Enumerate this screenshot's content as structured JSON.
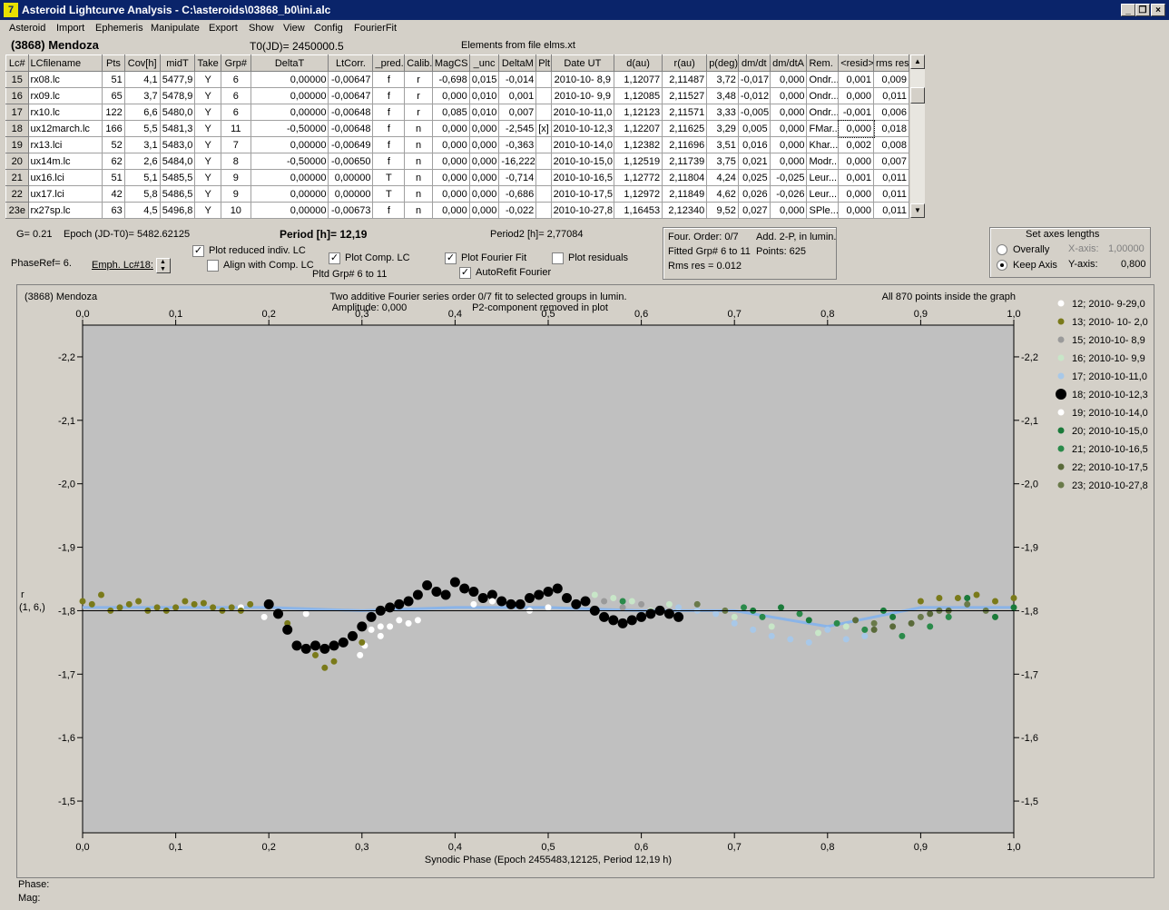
{
  "window": {
    "title": "Asteroid Lightcurve Analysis - C:\\asteroids\\03868_b0\\ini.alc",
    "min_label": "_",
    "max_label": "❐",
    "close_label": "×"
  },
  "menu": [
    "Asteroid",
    "Import",
    "Ephemeris",
    "Manipulate",
    "Export",
    "Show",
    "View",
    "Config",
    "FourierFit"
  ],
  "header": {
    "asteroid": "(3868) Mendoza",
    "t0": "T0(JD)= 2450000.5",
    "elements": "Elements from file elms.xt"
  },
  "table": {
    "columns": [
      "Lc#",
      "LCfilename",
      "Pts",
      "Cov[h]",
      "midT",
      "Take",
      "Grp#",
      "DeltaT",
      "LtCorr.",
      "_pred.",
      "Calib.",
      "MagCS",
      "_unc",
      "DeltaM",
      "Plt",
      "Date UT",
      "d(au)",
      "r(au)",
      "p(deg)",
      "dm/dt",
      "dm/dtA",
      "Rem.",
      "<resid>",
      "rms res"
    ],
    "rows": [
      [
        "15",
        "rx08.lc",
        "51",
        "4,1",
        "5477,9",
        "Y",
        "6",
        "0,00000",
        "-0,00647",
        "f",
        "r",
        "-0,698",
        "0,015",
        "-0,014",
        "",
        "2010-10- 8,9",
        "1,12077",
        "2,11487",
        "3,72",
        "-0,017",
        "0,000",
        "Ondr...",
        "0,001",
        "0,009"
      ],
      [
        "16",
        "rx09.lc",
        "65",
        "3,7",
        "5478,9",
        "Y",
        "6",
        "0,00000",
        "-0,00647",
        "f",
        "r",
        "0,000",
        "0,010",
        "0,001",
        "",
        "2010-10- 9,9",
        "1,12085",
        "2,11527",
        "3,48",
        "-0,012",
        "0,000",
        "Ondr...",
        "0,000",
        "0,011"
      ],
      [
        "17",
        "rx10.lc",
        "122",
        "6,6",
        "5480,0",
        "Y",
        "6",
        "0,00000",
        "-0,00648",
        "f",
        "r",
        "0,085",
        "0,010",
        "0,007",
        "",
        "2010-10-11,0",
        "1,12123",
        "2,11571",
        "3,33",
        "-0,005",
        "0,000",
        "Ondr...",
        "-0,001",
        "0,006"
      ],
      [
        "18",
        "ux12march.lc",
        "166",
        "5,5",
        "5481,3",
        "Y",
        "11",
        "-0,50000",
        "-0,00648",
        "f",
        "n",
        "0,000",
        "0,000",
        "-2,545",
        "[x]",
        "2010-10-12,3",
        "1,12207",
        "2,11625",
        "3,29",
        "0,005",
        "0,000",
        "FMar...",
        "0,000",
        "0,018"
      ],
      [
        "19",
        "rx13.lci",
        "52",
        "3,1",
        "5483,0",
        "Y",
        "7",
        "0,00000",
        "-0,00649",
        "f",
        "n",
        "0,000",
        "0,000",
        "-0,363",
        "",
        "2010-10-14,0",
        "1,12382",
        "2,11696",
        "3,51",
        "0,016",
        "0,000",
        "Khar...",
        "0,002",
        "0,008"
      ],
      [
        "20",
        "ux14m.lc",
        "62",
        "2,6",
        "5484,0",
        "Y",
        "8",
        "-0,50000",
        "-0,00650",
        "f",
        "n",
        "0,000",
        "0,000",
        "-16,222",
        "",
        "2010-10-15,0",
        "1,12519",
        "2,11739",
        "3,75",
        "0,021",
        "0,000",
        "Modr...",
        "0,000",
        "0,007"
      ],
      [
        "21",
        "ux16.lci",
        "51",
        "5,1",
        "5485,5",
        "Y",
        "9",
        "0,00000",
        "0,00000",
        "T",
        "n",
        "0,000",
        "0,000",
        "-0,714",
        "",
        "2010-10-16,5",
        "1,12772",
        "2,11804",
        "4,24",
        "0,025",
        "-0,025",
        "Leur...",
        "0,001",
        "0,011"
      ],
      [
        "22",
        "ux17.lci",
        "42",
        "5,8",
        "5486,5",
        "Y",
        "9",
        "0,00000",
        "0,00000",
        "T",
        "n",
        "0,000",
        "0,000",
        "-0,686",
        "",
        "2010-10-17,5",
        "1,12972",
        "2,11849",
        "4,62",
        "0,026",
        "-0,026",
        "Leur...",
        "0,000",
        "0,011"
      ],
      [
        "23e",
        "rx27sp.lc",
        "63",
        "4,5",
        "5496,8",
        "Y",
        "10",
        "0,00000",
        "-0,00673",
        "f",
        "n",
        "0,000",
        "0,000",
        "-0,022",
        "",
        "2010-10-27,8",
        "1,16453",
        "2,12340",
        "9,52",
        "0,027",
        "0,000",
        "SPle...",
        "0,000",
        "0,011"
      ]
    ]
  },
  "info": {
    "g": "G= 0.21",
    "epoch": "Epoch (JD-T0)= 5482.62125",
    "period": "Period [h]= 12,19",
    "period2": "Period2 [h]= 2,77084",
    "phaseref": "PhaseRef= 6.",
    "emph": "Emph. Lc#18:",
    "plot_reduced": "Plot reduced indiv. LC",
    "align_comp": "Align with Comp. LC",
    "plot_comp": "Plot Comp. LC",
    "pltd_grp": "Pltd Grp#  6  to   11",
    "plot_fourier": "Plot Fourier Fit",
    "autorefit": "AutoRefit Fourier",
    "plot_residuals": "Plot residuals",
    "four_order": "Four. Order:  0/7",
    "add2p": "Add. 2-P, in lumin.",
    "fitted_grp": "Fitted Grp# 6 to 11",
    "points": "Points: 625",
    "rms": "Rms res      = 0.012",
    "axes_title": "Set axes lengths",
    "overally": "Overally",
    "keep_axis": "Keep Axis",
    "xaxis_label": "X-axis:",
    "xaxis_val": "1,00000",
    "yaxis_label": "Y-axis:",
    "yaxis_val": "0,800"
  },
  "chart_data": {
    "type": "scatter",
    "name_label": "(3868) Mendoza",
    "title": "Two additive Fourier series order 0/7 fit to selected groups in lumin.",
    "subtitle_left": "Amplitude: 0,000",
    "subtitle_right": "P2-component removed in plot",
    "note": "All 870 points inside the graph",
    "xlabel": "Synodic Phase (Epoch 2455483,12125, Period 12,19 h)",
    "ylabel": "r",
    "ylabel2": "(1, 6,)",
    "xlim": [
      0.0,
      1.0
    ],
    "ylim": [
      -2.25,
      -1.45
    ],
    "x_ticks": [
      "0,0",
      "0,1",
      "0,2",
      "0,3",
      "0,4",
      "0,5",
      "0,6",
      "0,7",
      "0,8",
      "0,9",
      "1,0"
    ],
    "y_ticks": [
      {
        "v": -2.2,
        "t": "-2,2"
      },
      {
        "v": -2.1,
        "t": "-2,1"
      },
      {
        "v": -2.0,
        "t": "-2,0"
      },
      {
        "v": -1.9,
        "t": "-1,9"
      },
      {
        "v": -1.8,
        "t": "-1,8"
      },
      {
        "v": -1.7,
        "t": "-1,7"
      },
      {
        "v": -1.6,
        "t": "-1,6"
      },
      {
        "v": -1.5,
        "t": "-1,5"
      }
    ],
    "reference_line": -1.8,
    "fit_color": "#8ab4e8",
    "series": [
      {
        "name": "12; 2010- 9-29,0",
        "color": "#ffffff",
        "x": [
          0.17,
          0.195,
          0.24,
          0.298,
          0.303,
          0.32,
          0.33,
          0.35,
          0.36,
          0.48,
          0.5
        ],
        "y": [
          -1.805,
          -1.79,
          -1.795,
          -1.73,
          -1.745,
          -1.76,
          -1.775,
          -1.78,
          -1.785,
          -1.8,
          -1.805
        ]
      },
      {
        "name": "13; 2010- 10- 2,0",
        "color": "#7a7a1a",
        "x": [
          0.0,
          0.01,
          0.02,
          0.03,
          0.04,
          0.05,
          0.06,
          0.07,
          0.08,
          0.09,
          0.1,
          0.11,
          0.12,
          0.13,
          0.14,
          0.15,
          0.16,
          0.17,
          0.18,
          0.22,
          0.25,
          0.26,
          0.27,
          0.3,
          0.9,
          0.92,
          0.94,
          0.96,
          0.98,
          1.0
        ],
        "y": [
          -1.815,
          -1.81,
          -1.825,
          -1.8,
          -1.805,
          -1.81,
          -1.815,
          -1.8,
          -1.805,
          -1.8,
          -1.805,
          -1.815,
          -1.81,
          -1.812,
          -1.805,
          -1.8,
          -1.805,
          -1.8,
          -1.81,
          -1.78,
          -1.73,
          -1.71,
          -1.72,
          -1.75,
          -1.815,
          -1.82,
          -1.82,
          -1.825,
          -1.815,
          -1.82
        ]
      },
      {
        "name": "15; 2010-10- 8,9",
        "color": "#9a9a9a",
        "x": [
          0.56,
          0.58,
          0.6,
          0.62
        ],
        "y": [
          -1.815,
          -1.805,
          -1.81,
          -1.8
        ]
      },
      {
        "name": "16; 2010-10- 9,9",
        "color": "#c8e6c8",
        "x": [
          0.55,
          0.57,
          0.59,
          0.61,
          0.63,
          0.7,
          0.74,
          0.79,
          0.82
        ],
        "y": [
          -1.825,
          -1.82,
          -1.815,
          -1.8,
          -1.81,
          -1.79,
          -1.775,
          -1.765,
          -1.775
        ]
      },
      {
        "name": "17; 2010-10-11,0",
        "color": "#a8c8e8",
        "x": [
          0.64,
          0.66,
          0.68,
          0.7,
          0.72,
          0.74,
          0.76,
          0.78,
          0.8,
          0.82,
          0.84
        ],
        "y": [
          -1.805,
          -1.8,
          -1.795,
          -1.78,
          -1.77,
          -1.76,
          -1.755,
          -1.75,
          -1.77,
          -1.755,
          -1.76
        ]
      },
      {
        "name": "18; 2010-10-12,3",
        "color": "#000000",
        "x": [
          0.2,
          0.21,
          0.22,
          0.23,
          0.24,
          0.25,
          0.26,
          0.27,
          0.28,
          0.29,
          0.3,
          0.31,
          0.32,
          0.33,
          0.34,
          0.35,
          0.36,
          0.37,
          0.38,
          0.39,
          0.4,
          0.41,
          0.42,
          0.43,
          0.44,
          0.45,
          0.46,
          0.47,
          0.48,
          0.49,
          0.5,
          0.51,
          0.52,
          0.53,
          0.54,
          0.55,
          0.56,
          0.57,
          0.58,
          0.59,
          0.6,
          0.61,
          0.62,
          0.63,
          0.64
        ],
        "y": [
          -1.81,
          -1.795,
          -1.77,
          -1.745,
          -1.74,
          -1.745,
          -1.74,
          -1.745,
          -1.75,
          -1.76,
          -1.775,
          -1.79,
          -1.8,
          -1.805,
          -1.81,
          -1.815,
          -1.825,
          -1.84,
          -1.83,
          -1.825,
          -1.845,
          -1.835,
          -1.83,
          -1.82,
          -1.825,
          -1.815,
          -1.81,
          -1.81,
          -1.82,
          -1.825,
          -1.83,
          -1.835,
          -1.82,
          -1.81,
          -1.815,
          -1.8,
          -1.79,
          -1.785,
          -1.78,
          -1.785,
          -1.79,
          -1.795,
          -1.8,
          -1.795,
          -1.79
        ]
      },
      {
        "name": "19; 2010-10-14,0",
        "color": "#ffffff",
        "x": [
          0.31,
          0.32,
          0.34,
          0.42,
          0.44
        ],
        "y": [
          -1.77,
          -1.775,
          -1.785,
          -1.81,
          -1.815
        ]
      },
      {
        "name": "20; 2010-10-15,0",
        "color": "#1a7a3a",
        "x": [
          0.72,
          0.75,
          0.78,
          0.86,
          0.87,
          0.95,
          0.98,
          1.0
        ],
        "y": [
          -1.8,
          -1.805,
          -1.785,
          -1.8,
          -1.79,
          -1.82,
          -1.79,
          -1.805
        ]
      },
      {
        "name": "21; 2010-10-16,5",
        "color": "#2a8a4a",
        "x": [
          0.58,
          0.71,
          0.73,
          0.77,
          0.81,
          0.84,
          0.88,
          0.91,
          0.93
        ],
        "y": [
          -1.815,
          -1.805,
          -1.79,
          -1.795,
          -1.78,
          -1.77,
          -1.76,
          -1.775,
          -1.79
        ]
      },
      {
        "name": "22; 2010-10-17,5",
        "color": "#5a6a3a",
        "x": [
          0.83,
          0.85,
          0.87,
          0.89,
          0.91,
          0.93
        ],
        "y": [
          -1.785,
          -1.77,
          -1.775,
          -1.78,
          -1.795,
          -1.8
        ]
      },
      {
        "name": "23; 2010-10-27,8",
        "color": "#6a7a4a",
        "x": [
          0.66,
          0.69,
          0.85,
          0.9,
          0.92,
          0.95,
          0.97
        ],
        "y": [
          -1.81,
          -1.8,
          -1.78,
          -1.79,
          -1.8,
          -1.81,
          -1.8
        ]
      }
    ],
    "fit_curve": {
      "x": [
        0.0,
        0.1,
        0.2,
        0.3,
        0.4,
        0.5,
        0.6,
        0.7,
        0.8,
        0.9,
        1.0
      ],
      "y": [
        -1.805,
        -1.805,
        -1.805,
        -1.8,
        -1.805,
        -1.805,
        -1.8,
        -1.8,
        -1.775,
        -1.805,
        -1.805
      ]
    }
  },
  "status": {
    "phase": "Phase:",
    "mag": "Mag:"
  }
}
